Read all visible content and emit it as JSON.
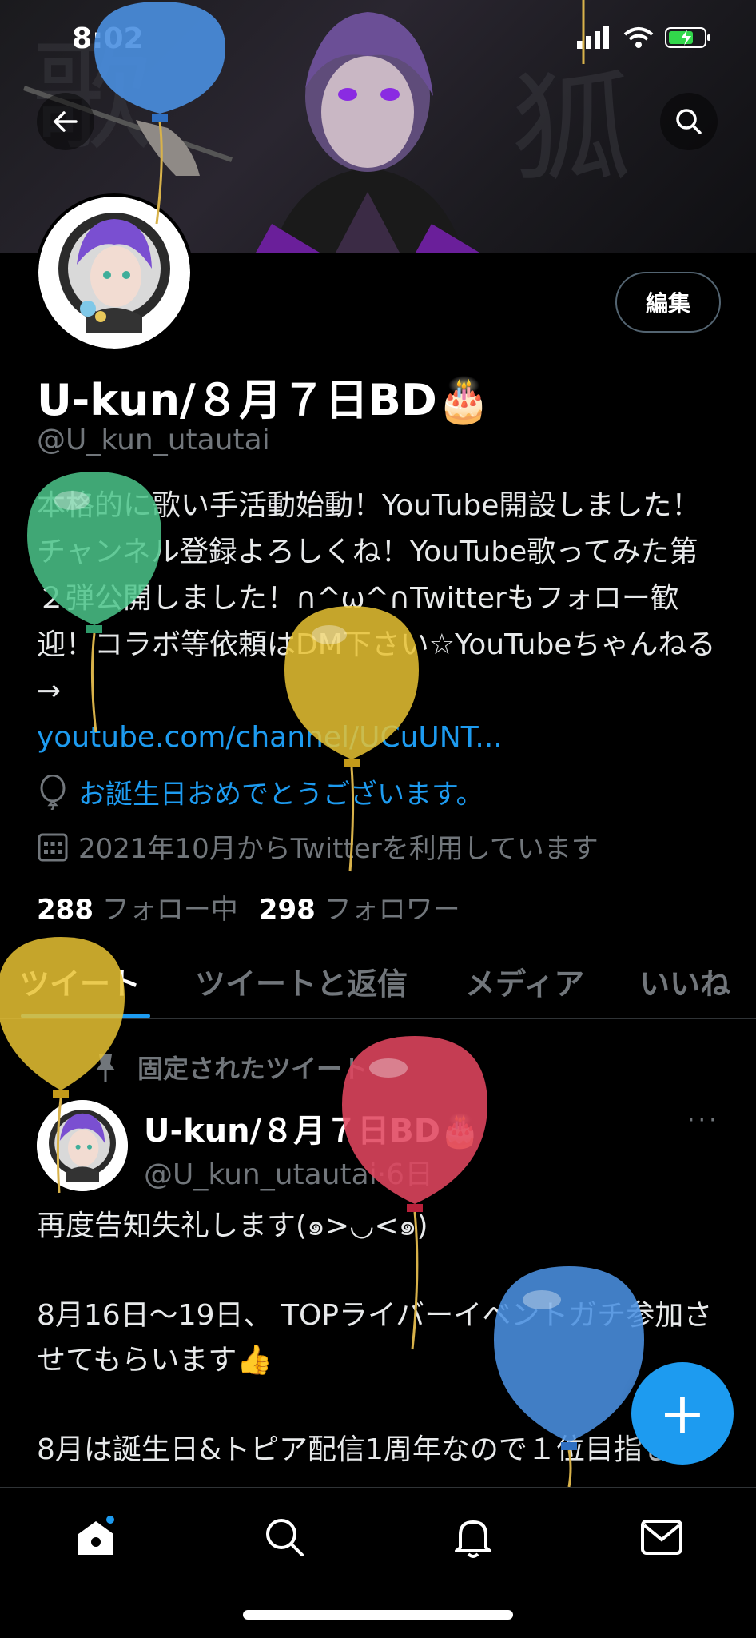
{
  "status": {
    "time": "8:02"
  },
  "profile": {
    "edit_label": "編集",
    "name": "U-kun/８月７日BD🎂",
    "handle": "@U_kun_utautai",
    "bio": "本格的に歌い手活動始動！YouTube開設しました！チャンネル登録よろしくね！YouTube歌ってみた第２弾公開しました！∩^ω^∩Twitterもフォロー歓迎！コラボ等依頼はDM下さい☆YouTubeちゃんねる→",
    "bio_link": "youtube.com/channel/UCuUNT...",
    "birthday_text": "お誕生日おめでとうございます。",
    "joined_text": "2021年10月からTwitterを利用しています",
    "following_count": "288",
    "following_label": "フォロー中",
    "followers_count": "298",
    "followers_label": "フォロワー"
  },
  "tabs": [
    "ツイート",
    "ツイートと返信",
    "メディア",
    "いいね"
  ],
  "pinned_tweet": {
    "pinned_label": "固定されたツイート",
    "author_name": "U-kun/８月７日BD🎂",
    "author_handle": "@U_kun_utautai",
    "time": "6日",
    "more": "···",
    "body": "再度告知失礼します(๑>◡<๑)\n\n8月16日〜19日、 TOPライバーイベントガチ参加させてもらいます👍\n\n8月は誕生日&トピア配信1周年なので１位目指し…"
  },
  "fab": {
    "label": "+"
  },
  "icons": {
    "back": "back-arrow-icon",
    "search": "search-icon",
    "birthday": "balloon-icon",
    "calendar": "calendar-icon",
    "pin": "pin-icon",
    "home": "home-icon",
    "explore": "search-icon",
    "notifications": "bell-icon",
    "messages": "mail-icon"
  },
  "colors": {
    "accent": "#1d9bf0",
    "background": "#000000",
    "muted": "#71767b"
  }
}
